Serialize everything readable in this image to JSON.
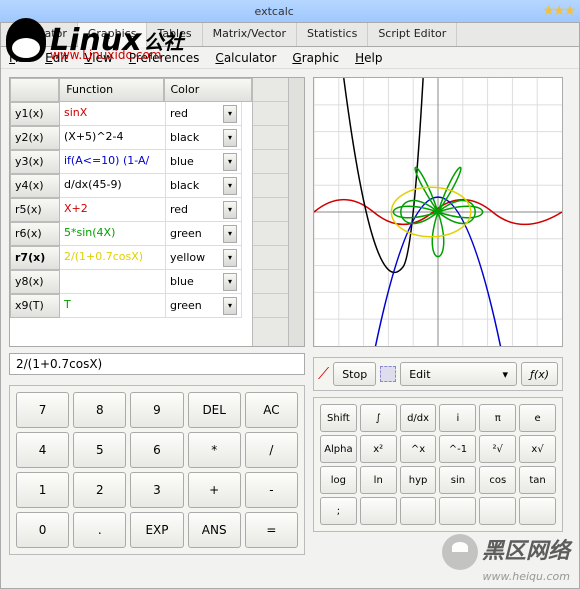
{
  "title": "extcalc",
  "tabs": [
    "Calculator",
    "Graphics",
    "Tables",
    "Matrix/Vector",
    "Statistics",
    "Script Editor"
  ],
  "menu": [
    "File",
    "Edit",
    "View",
    "Preferences",
    "Calculator",
    "Graphic",
    "Help"
  ],
  "table": {
    "headers": {
      "blank": "",
      "func": "Function",
      "color": "Color"
    },
    "rows": [
      {
        "name": "y1(x)",
        "func": "sinX",
        "color": "red",
        "fc": "#d00000"
      },
      {
        "name": "y2(x)",
        "func": "(X+5)^2-4",
        "color": "black",
        "fc": "#000"
      },
      {
        "name": "y3(x)",
        "func": "if(A<=10) (1-A/",
        "color": "blue",
        "fc": "#0000d0"
      },
      {
        "name": "y4(x)",
        "func": "d/dx(45-9)",
        "color": "black",
        "fc": "#000"
      },
      {
        "name": "r5(x)",
        "func": "X+2",
        "color": "red",
        "fc": "#d00000"
      },
      {
        "name": "r6(x)",
        "func": "5*sin(4X)",
        "color": "green",
        "fc": "#00a000"
      },
      {
        "name": "r7(x)",
        "func": "2/(1+0.7cosX)",
        "color": "yellow",
        "fc": "#e0d000",
        "bold": true
      },
      {
        "name": "y8(x)",
        "func": "",
        "color": "blue",
        "fc": "#000"
      },
      {
        "name": "x9(T)",
        "func": "T",
        "color": "green",
        "fc": "#00a000"
      }
    ]
  },
  "input": "2/(1+0.7cosX)",
  "keypad": [
    "7",
    "8",
    "9",
    "DEL",
    "AC",
    "4",
    "5",
    "6",
    "*",
    "/",
    "1",
    "2",
    "3",
    "+",
    "-",
    "0",
    ".",
    "EXP",
    "ANS",
    "="
  ],
  "toolbar": {
    "stop": "Stop",
    "edit": "Edit",
    "fx": "ƒ(x)"
  },
  "scipad": [
    "Shift",
    "∫",
    "d/dx",
    "i",
    "π",
    "e",
    "Alpha",
    "x²",
    "^x",
    "^-1",
    "²√",
    "x√",
    "log",
    "ln",
    "hyp",
    "sin",
    "cos",
    "tan",
    ";",
    "",
    "",
    "",
    "",
    ""
  ],
  "watermarks": {
    "w1": {
      "text": "Linux",
      "cn": "公社",
      "url": "www.Linuxidc.com"
    },
    "w2": {
      "text": "黑区网络",
      "url": "www.heiqu.com"
    }
  }
}
